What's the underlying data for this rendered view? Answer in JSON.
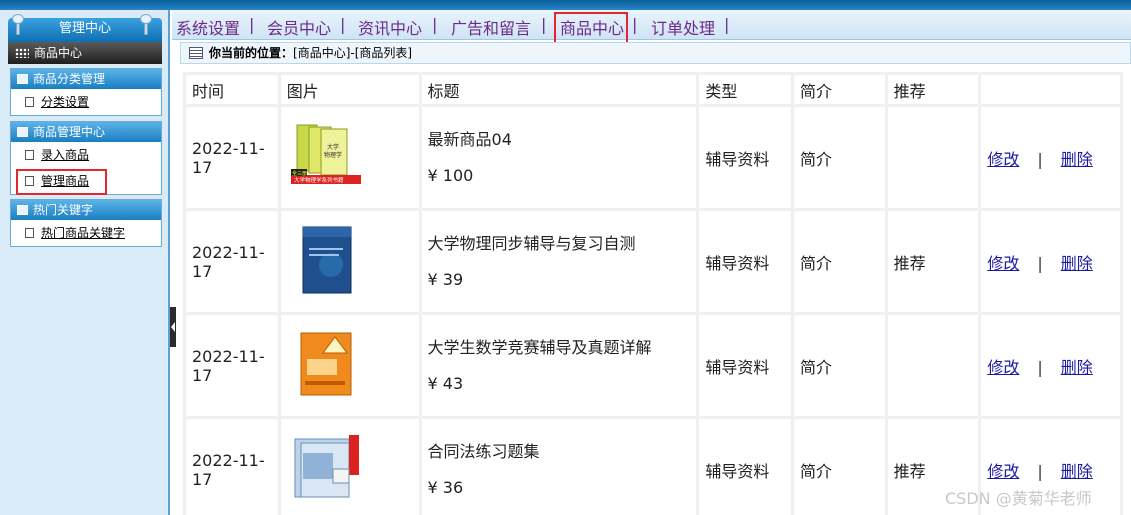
{
  "sidebar": {
    "header": "管理中心",
    "sub_header": "商品中心",
    "groups": [
      {
        "title": "商品分类管理",
        "items": [
          "分类设置"
        ]
      },
      {
        "title": "商品管理中心",
        "items": [
          "录入商品",
          "管理商品"
        ]
      },
      {
        "title": "热门关键字",
        "items": [
          "热门商品关键字"
        ]
      }
    ]
  },
  "topnav": {
    "items": [
      "系统设置",
      "会员中心",
      "资讯中心",
      "广告和留言",
      "商品中心",
      "订单处理"
    ],
    "separator": "|",
    "active": "商品中心"
  },
  "breadcrumb": {
    "label": "你当前的位置：",
    "path": "[商品中心]-[商品列表]"
  },
  "table": {
    "headers": [
      "时间",
      "图片",
      "标题",
      "类型",
      "简介",
      "推荐",
      ""
    ],
    "action_edit": "修改",
    "action_sep": "|",
    "action_delete": "删除",
    "rows": [
      {
        "time": "2022-11-17",
        "title": "最新商品04",
        "price": "¥ 100",
        "type": "辅导资料",
        "intro": "简介",
        "recommend": "",
        "cover_caption": "大学物理学系列书籍",
        "cover_tag": "全三册"
      },
      {
        "time": "2022-11-17",
        "title": "大学物理同步辅导与复习自测",
        "price": "¥ 39",
        "type": "辅导资料",
        "intro": "简介",
        "recommend": "推荐"
      },
      {
        "time": "2022-11-17",
        "title": "大学生数学竞赛辅导及真题详解",
        "price": "¥ 43",
        "type": "辅导资料",
        "intro": "简介",
        "recommend": ""
      },
      {
        "time": "2022-11-17",
        "title": "合同法练习题集",
        "price": "¥ 36",
        "type": "辅导资料",
        "intro": "简介",
        "recommend": "推荐"
      }
    ]
  },
  "watermark": "CSDN @黄菊华老师",
  "colors": {
    "highlight": "#e0282e",
    "nav_text": "#6b2a8a",
    "link": "#1a1aa6",
    "sidebar_header": "#1a7ec2"
  }
}
